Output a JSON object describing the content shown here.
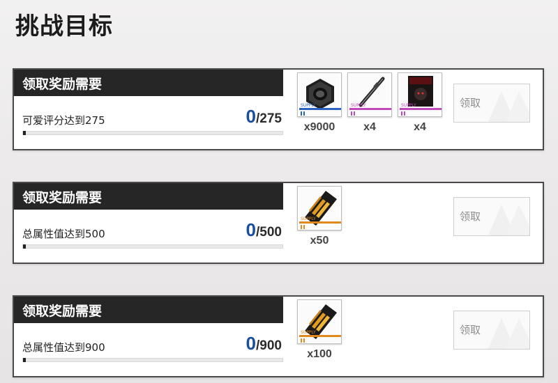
{
  "header": {
    "title": "挑战目标"
  },
  "tasks": [
    {
      "banner": "领取奖励需要",
      "condition": "可爱评分达到275",
      "current": "0",
      "separator": "/",
      "total": "275",
      "progress_fraction": 0,
      "claim_label": "领取",
      "rewards": [
        {
          "icon": "hex-nut-icon",
          "supply_label": "SUPPLY",
          "quantity": "x9000",
          "color": "#2a63c4"
        },
        {
          "icon": "rod-part-icon",
          "supply_label": "SUPPLY",
          "quantity": "x4",
          "color": "#c04aba"
        },
        {
          "icon": "character-card-icon",
          "supply_label": "SUPPLY",
          "quantity": "x4",
          "color": "#c04aba"
        }
      ]
    },
    {
      "banner": "领取奖励需要",
      "condition": "总属性值达到500",
      "current": "0",
      "separator": "/",
      "total": "500",
      "progress_fraction": 0,
      "claim_label": "领取",
      "rewards": [
        {
          "icon": "gold-ticket-icon",
          "supply_label": "SUPPLY",
          "quantity": "x50",
          "color": "#e08a1e"
        }
      ]
    },
    {
      "banner": "领取奖励需要",
      "condition": "总属性值达到900",
      "current": "0",
      "separator": "/",
      "total": "900",
      "progress_fraction": 0,
      "claim_label": "领取",
      "rewards": [
        {
          "icon": "gold-ticket-icon",
          "supply_label": "SUPPLY",
          "quantity": "x100",
          "color": "#e08a1e"
        }
      ]
    }
  ]
}
